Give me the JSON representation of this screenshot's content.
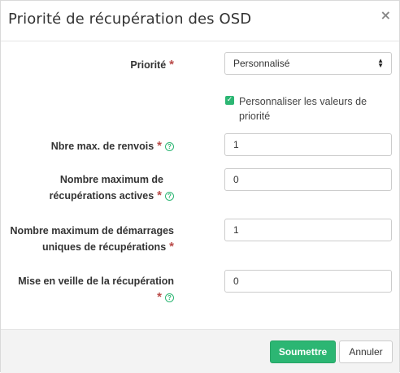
{
  "modal": {
    "title": "Priorité de récupération des OSD",
    "close_glyph": "×"
  },
  "form": {
    "priority": {
      "label": "Priorité",
      "required": "*",
      "value": "Personnalisé"
    },
    "customize": {
      "checked": true,
      "label": "Personnaliser les valeurs de priorité"
    },
    "max_backfills": {
      "label": "Nbre max. de renvois",
      "required": "*",
      "help_icon": "question-circle-icon",
      "value": "1"
    },
    "max_active_recoveries": {
      "label_line1": "Nombre maximum de",
      "label_line2": "récupérations actives",
      "required": "*",
      "help_icon": "question-circle-icon",
      "value": "0"
    },
    "max_single_start": {
      "label_line1": "Nombre maximum de démarrages",
      "label_line2": "uniques de récupérations",
      "required": "*",
      "value": "1"
    },
    "recovery_sleep": {
      "label": "Mise en veille de la récupération",
      "required": "*",
      "help_icon": "question-circle-icon",
      "value": "0"
    }
  },
  "footer": {
    "submit_label": "Soumettre",
    "cancel_label": "Annuler"
  },
  "colors": {
    "accent": "#2cb673",
    "required": "#b94a48"
  }
}
